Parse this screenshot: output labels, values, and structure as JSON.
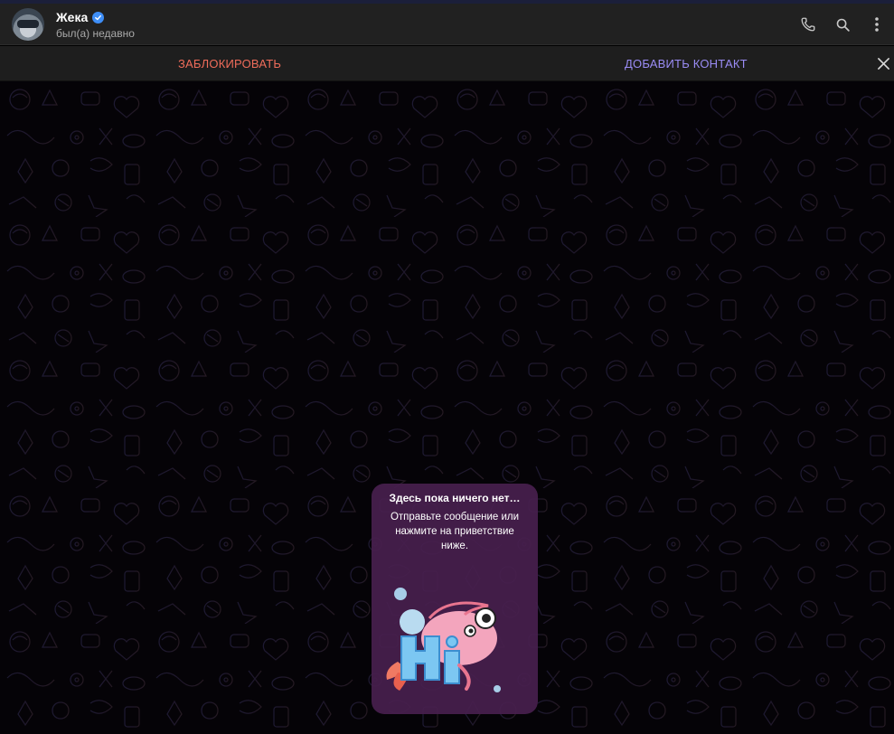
{
  "header": {
    "name": "Жека",
    "status": "был(а) недавно",
    "icons": [
      "phone-icon",
      "search-icon",
      "more-vertical-icon"
    ],
    "verified": true
  },
  "action_bar": {
    "block_label": "ЗАБЛОКИРОВАТЬ",
    "add_contact_label": "ДОБАВИТЬ КОНТАКТ"
  },
  "empty_state": {
    "title": "Здесь пока ничего нет…",
    "text": "Отправьте сообщение или нажмите на приветствие ниже.",
    "sticker": "hi-shrimp-sticker"
  },
  "colors": {
    "header_bg": "#212121",
    "block_color": "#ef6c5a",
    "add_color": "#9a8cf5",
    "card_bg": "#48204e",
    "verified": "#3e8ef7"
  }
}
